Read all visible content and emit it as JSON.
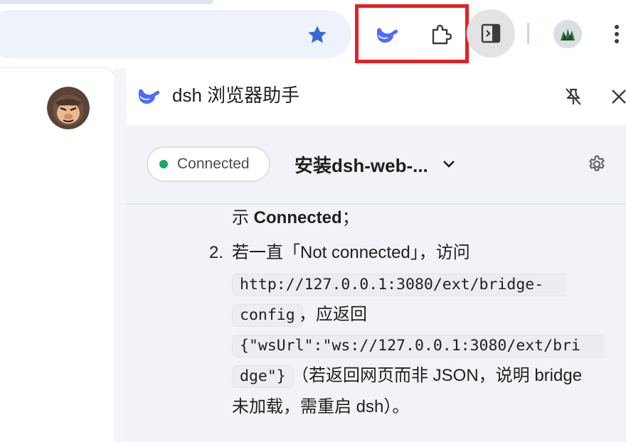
{
  "toolbar": {
    "bookmark_icon": "star-icon",
    "extension_icons": [
      "dsh-whale-icon",
      "puzzle-piece-icon"
    ],
    "side_panel_icon": "side-panel-icon",
    "menu_icon": "more-vertical-icon"
  },
  "panel": {
    "title": "dsh 浏览器助手",
    "status": {
      "label": "Connected",
      "color": "#1fa463"
    },
    "session": {
      "title": "安装dsh-web-..."
    }
  },
  "message": {
    "line1": {
      "prefix": "示 ",
      "bold": "Connected",
      "suffix": "；"
    },
    "item2": {
      "number": "2.",
      "text": "若一直「Not connected」，访问",
      "code_url_part1": "http://127.0.0.1:3080/ext/bridge-",
      "code_url_part2": "config",
      "after_url": "，应返回",
      "code_json_part1": "{\"wsUrl\":\"ws://127.0.0.1:3080/ext/bri",
      "code_json_part2": "dge\"}",
      "after_json": "（若返回网页而非 JSON，说明 bridge",
      "last_line": "未加载，需重启 dsh）。"
    }
  },
  "colors": {
    "accent_blue": "#4d6bfe",
    "highlight_red": "#e51f25",
    "star_blue": "#3b66d6"
  }
}
